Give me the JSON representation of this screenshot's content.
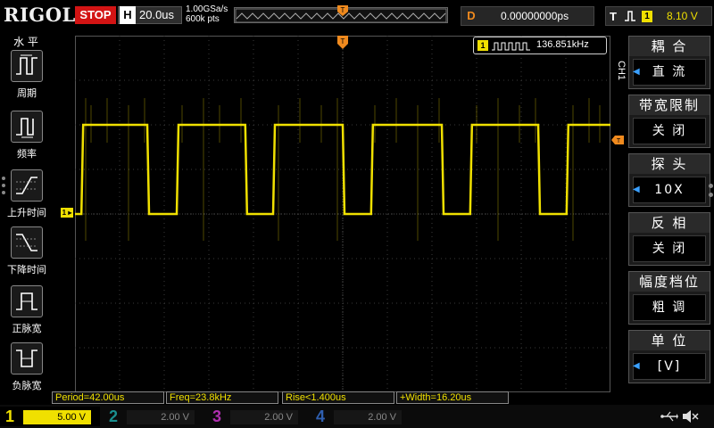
{
  "brand": "RIGOL",
  "status": {
    "run_state": "STOP"
  },
  "horizontal": {
    "label": "H",
    "timebase": "20.0us",
    "sample_rate": "1.00GSa/s",
    "memory_depth": "600k pts"
  },
  "delay": {
    "label": "D",
    "value": "0.00000000ps"
  },
  "trigger": {
    "label": "T",
    "edge": "rising",
    "source": "1",
    "level": "8.10 V"
  },
  "left_menu": {
    "title": "水 平",
    "items": [
      {
        "label": "周期",
        "icon": "period-icon"
      },
      {
        "label": "频率",
        "icon": "frequency-icon"
      },
      {
        "label": "上升时间",
        "icon": "rise-time-icon"
      },
      {
        "label": "下降时间",
        "icon": "fall-time-icon"
      },
      {
        "label": "正脉宽",
        "icon": "positive-width-icon"
      },
      {
        "label": "负脉宽",
        "icon": "negative-width-icon"
      }
    ]
  },
  "freq_counter": {
    "channel": "1",
    "value": "136.851kHz"
  },
  "waveform": {
    "channel": "1",
    "color": "#f0e000",
    "high_level": 0.25,
    "low_level": 0.5
  },
  "side_label": "CH1",
  "measurements": [
    {
      "text": "Period=42.00us"
    },
    {
      "text": "Freq=23.8kHz"
    },
    {
      "text": "Rise<1.400us"
    },
    {
      "text": "+Width=16.20us"
    }
  ],
  "right_menu": [
    {
      "title": "耦 合",
      "value": "直 流",
      "has_arrow": true
    },
    {
      "title": "带宽限制",
      "value": "关 闭",
      "has_arrow": false
    },
    {
      "title": "探 头",
      "value": "10X",
      "has_arrow": true
    },
    {
      "title": "反 相",
      "value": "关 闭",
      "has_arrow": false
    },
    {
      "title": "幅度档位",
      "value": "粗 调",
      "has_arrow": false
    },
    {
      "title": "单 位",
      "value": "[V]",
      "has_arrow": true
    }
  ],
  "channels": [
    {
      "num": "1",
      "scale": "5.00 V",
      "color": "#f0e000",
      "active": true
    },
    {
      "num": "2",
      "scale": "2.00 V",
      "color": "#1a8f8f",
      "active": false
    },
    {
      "num": "3",
      "scale": "2.00 V",
      "color": "#b02fb0",
      "active": false
    },
    {
      "num": "4",
      "scale": "2.00 V",
      "color": "#2f5fb0",
      "active": false
    }
  ],
  "colors": {
    "ch1": "#f0e000",
    "stop": "#d31414",
    "delay": "#f08a1e",
    "trigger_marker": "#f08a1e"
  }
}
